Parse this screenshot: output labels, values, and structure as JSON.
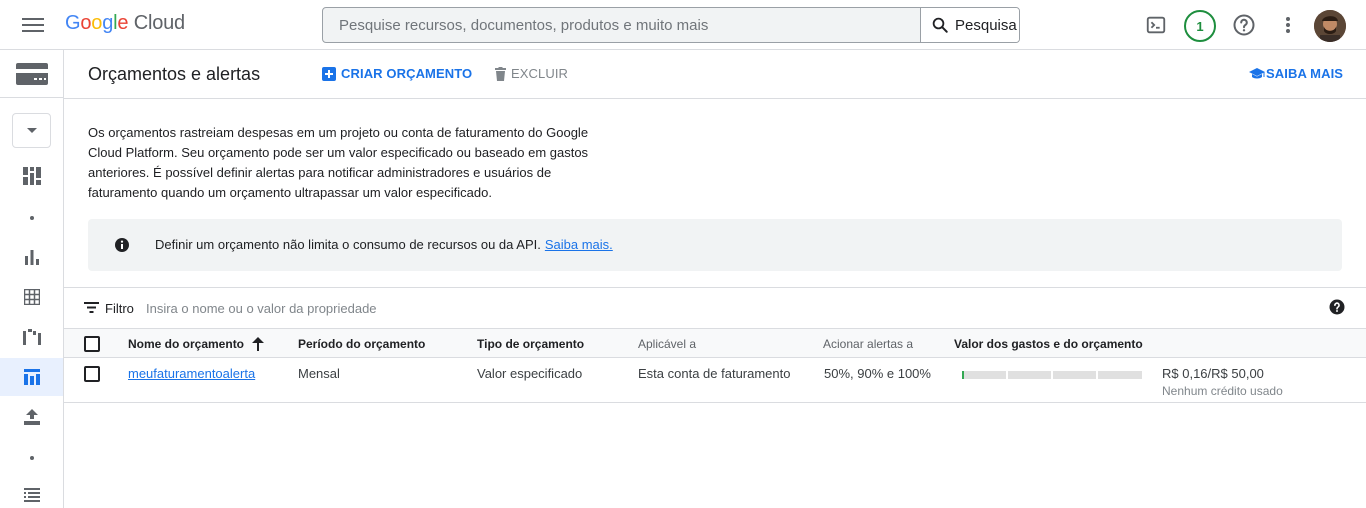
{
  "topbar": {
    "logo": {
      "g1": "G",
      "g2": "o",
      "g3": "o",
      "g4": "g",
      "g5": "l",
      "g6": "e",
      "product": "Cloud"
    },
    "search_placeholder": "Pesquise recursos, documentos, produtos e muito mais",
    "search_button_label": "Pesquisa",
    "notification_count": "1"
  },
  "header": {
    "title": "Orçamentos e alertas",
    "create_label": "CRIAR ORÇAMENTO",
    "delete_label": "EXCLUIR",
    "learn_more_label": "SAIBA MAIS"
  },
  "description": "Os orçamentos rastreiam despesas em um projeto ou conta de faturamento do Google Cloud Platform. Seu orçamento pode ser um valor especificado ou baseado em gastos anteriores. É possível definir alertas para notificar administradores e usuários de faturamento quando um orçamento ultrapassar um valor especificado.",
  "info": {
    "text": "Definir um orçamento não limita o consumo de recursos ou da API.",
    "link": "Saiba mais."
  },
  "filter": {
    "label": "Filtro",
    "placeholder": "Insira o nome ou o valor da propriedade"
  },
  "table": {
    "columns": {
      "name": "Nome do orçamento",
      "period": "Período do orçamento",
      "type": "Tipo de orçamento",
      "applies_to": "Aplicável a",
      "alerts": "Acionar alertas a",
      "spend": "Valor dos gastos e do orçamento"
    },
    "rows": [
      {
        "name": "meufaturamentoalerta",
        "period": "Mensal",
        "type": "Valor especificado",
        "applies_to": "Esta conta de faturamento",
        "alerts": "50%, 90% e 100%",
        "amount": "R$ 0,16/R$ 50,00",
        "credit": "Nenhum crédito usado",
        "spend_fraction": 0.0032
      }
    ]
  },
  "colors": {
    "accent": "#1a73e8",
    "notification": "#1e8e3e",
    "spend_fill": "#34a853"
  }
}
